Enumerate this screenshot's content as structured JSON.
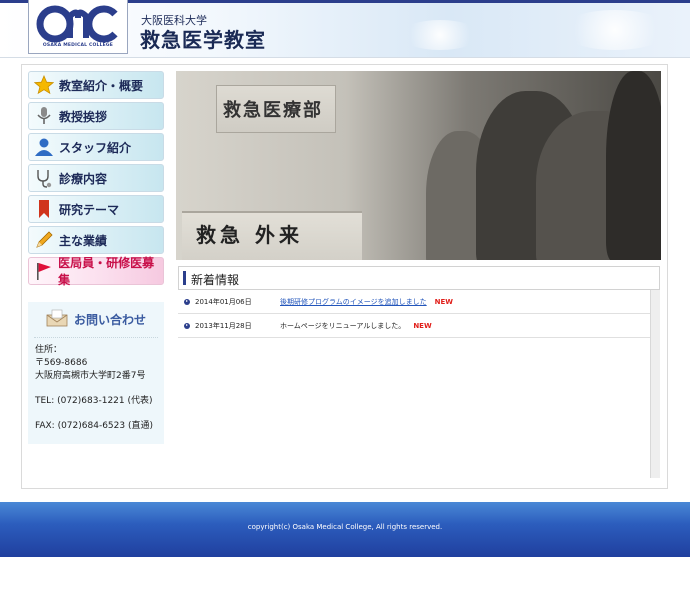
{
  "header": {
    "logo_text": "OMC",
    "logo_sub": "OSAKA MEDICAL COLLEGE",
    "university": "大阪医科大学",
    "department": "救急医学教室"
  },
  "nav": {
    "items": [
      {
        "label": "教室紹介・概要",
        "icon": "star-icon"
      },
      {
        "label": "教授挨拶",
        "icon": "microphone-icon"
      },
      {
        "label": "スタッフ紹介",
        "icon": "person-icon"
      },
      {
        "label": "診療内容",
        "icon": "stethoscope-icon"
      },
      {
        "label": "研究テーマ",
        "icon": "bookmark-icon"
      },
      {
        "label": "主な業績",
        "icon": "pencil-icon"
      },
      {
        "label": "医局員・研修医募集",
        "icon": "flag-icon"
      }
    ]
  },
  "contact": {
    "title": "お問い合わせ",
    "address_label": "住所：",
    "postal": "〒569-8686",
    "address": "大阪府高槻市大学町2番7号",
    "tel": "TEL: (072)683-1221 (代表)",
    "fax": "FAX: (072)684-6523 (直通)"
  },
  "hero": {
    "sign_top": "救急医療部",
    "sign_bottom": "救急 外来"
  },
  "news": {
    "title": "新着情報",
    "items": [
      {
        "date": "2014年01月06日",
        "text": "後期研修プログラムのイメージを追加しました",
        "is_link": true,
        "badge": "NEW"
      },
      {
        "date": "2013年11月28日",
        "text": "ホームページをリニューアルしました。",
        "is_link": false,
        "badge": "NEW"
      }
    ]
  },
  "footer": {
    "copyright": "copyright(c) Osaka Medical College, All rights reserved."
  },
  "colors": {
    "brand_navy": "#2b3e8c",
    "new_badge": "#e1201b",
    "link": "#2255bb",
    "footer_blue": "#2c5dbd"
  }
}
